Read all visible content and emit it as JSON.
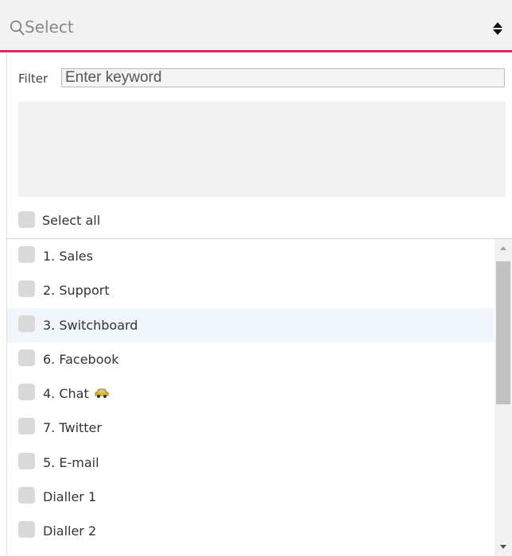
{
  "select": {
    "placeholder": "Select"
  },
  "filter": {
    "label": "Filter",
    "placeholder": "Enter keyword"
  },
  "select_all": {
    "label": "Select all"
  },
  "items": [
    {
      "label": "1. Sales"
    },
    {
      "label": "2. Support"
    },
    {
      "label": "3. Switchboard"
    },
    {
      "label": "6. Facebook"
    },
    {
      "label": "4. Chat"
    },
    {
      "label": "7. Twitter"
    },
    {
      "label": "5. E-mail"
    },
    {
      "label": "Dialler 1"
    },
    {
      "label": "Dialler 2"
    }
  ],
  "colors": {
    "accent": "#e0245e",
    "highlight": "#f0f6fc"
  },
  "icons": {
    "search": "search-icon",
    "sort": "sort-icon",
    "chat_item": "car-icon"
  }
}
